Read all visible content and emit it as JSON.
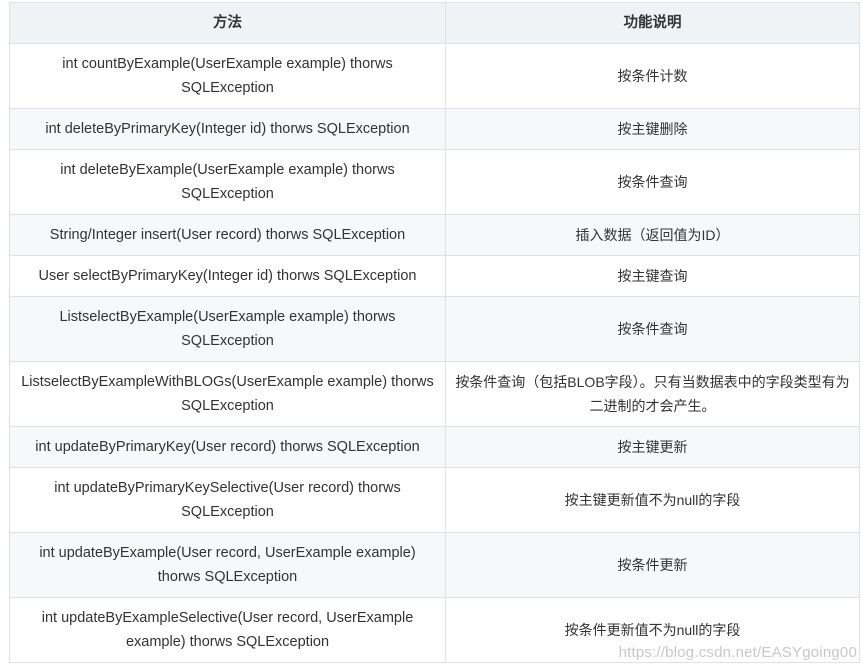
{
  "table": {
    "headers": [
      "方法",
      "功能说明"
    ],
    "rows": [
      {
        "method": "int countByExample(UserExample example) thorws SQLException",
        "description": "按条件计数"
      },
      {
        "method": "int deleteByPrimaryKey(Integer id) thorws SQLException",
        "description": "按主键删除"
      },
      {
        "method": "int deleteByExample(UserExample example) thorws SQLException",
        "description": "按条件查询"
      },
      {
        "method": "String/Integer insert(User record) thorws SQLException",
        "description": "插入数据（返回值为ID）"
      },
      {
        "method": "User selectByPrimaryKey(Integer id) thorws SQLException",
        "description": "按主键查询"
      },
      {
        "method": "ListselectByExample(UserExample example) thorws SQLException",
        "description": "按条件查询"
      },
      {
        "method": "ListselectByExampleWithBLOGs(UserExample example) thorws SQLException",
        "description": "按条件查询（包括BLOB字段）。只有当数据表中的字段类型有为二进制的才会产生。"
      },
      {
        "method": "int updateByPrimaryKey(User record) thorws SQLException",
        "description": "按主键更新"
      },
      {
        "method": "int updateByPrimaryKeySelective(User record) thorws SQLException",
        "description": "按主键更新值不为null的字段"
      },
      {
        "method": "int updateByExample(User record, UserExample example) thorws SQLException",
        "description": "按条件更新"
      },
      {
        "method": "int updateByExampleSelective(User record, UserExample example) thorws SQLException",
        "description": "按条件更新值不为null的字段"
      }
    ]
  },
  "watermark": "https://blog.csdn.net/EASYgoing00"
}
